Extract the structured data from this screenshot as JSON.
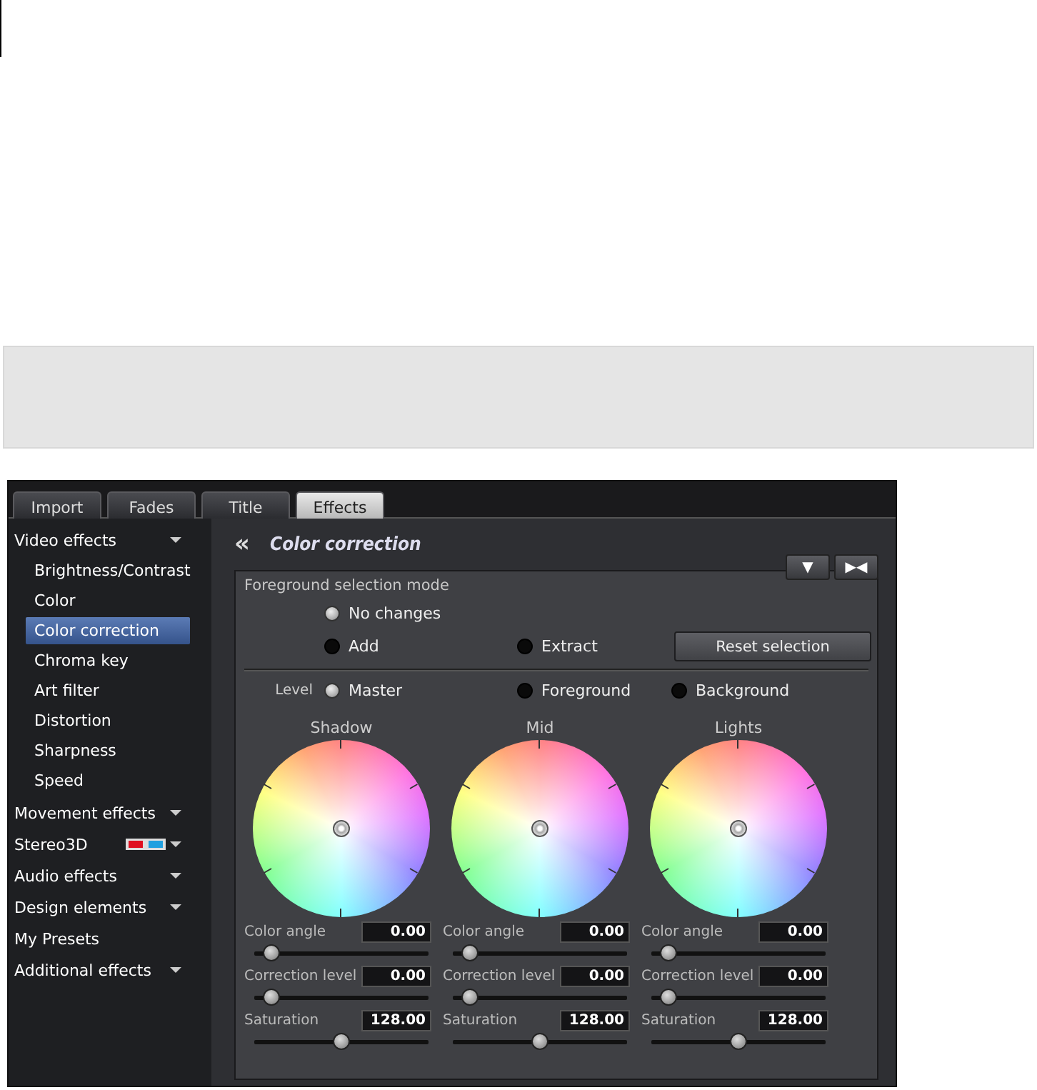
{
  "tabs": [
    {
      "label": "Import",
      "selected": false
    },
    {
      "label": "Fades",
      "selected": false
    },
    {
      "label": "Title",
      "selected": false
    },
    {
      "label": "Effects",
      "selected": true
    }
  ],
  "sidebar": {
    "items": [
      {
        "label": "Video effects",
        "kind": "menu",
        "children": [
          {
            "label": "Brightness/Contrast",
            "selected": false
          },
          {
            "label": "Color",
            "selected": false
          },
          {
            "label": "Color correction",
            "selected": true
          },
          {
            "label": "Chroma key",
            "selected": false
          },
          {
            "label": "Art filter",
            "selected": false
          },
          {
            "label": "Distortion",
            "selected": false
          },
          {
            "label": "Sharpness",
            "selected": false
          },
          {
            "label": "Speed",
            "selected": false
          }
        ]
      },
      {
        "label": "Movement effects",
        "kind": "menu"
      },
      {
        "label": "Stereo3D",
        "kind": "menu-3d"
      },
      {
        "label": "Audio effects",
        "kind": "menu"
      },
      {
        "label": "Design elements",
        "kind": "menu"
      },
      {
        "label": "My Presets",
        "kind": "plain"
      },
      {
        "label": "Additional effects",
        "kind": "menu"
      }
    ]
  },
  "panel": {
    "back": "«",
    "title": "Color correction",
    "corner_buttons": [
      "▼",
      "▶◀"
    ],
    "selection_mode": {
      "label": "Foreground selection mode",
      "options": [
        {
          "label": "No changes",
          "selected": true
        },
        {
          "label": "Add",
          "selected": false
        },
        {
          "label": "Extract",
          "selected": false
        }
      ],
      "reset_button": "Reset selection"
    },
    "level": {
      "label": "Level",
      "options": [
        {
          "label": "Master",
          "selected": true
        },
        {
          "label": "Foreground",
          "selected": false
        },
        {
          "label": "Background",
          "selected": false
        }
      ]
    },
    "wheels": [
      {
        "title": "Shadow",
        "params": [
          {
            "label": "Color angle",
            "value": "0.00",
            "level": 0.1
          },
          {
            "label": "Correction level",
            "value": "0.00",
            "level": 0.1
          },
          {
            "label": "Saturation",
            "value": "128.00",
            "level": 0.5
          }
        ]
      },
      {
        "title": "Mid",
        "params": [
          {
            "label": "Color angle",
            "value": "0.00",
            "level": 0.1
          },
          {
            "label": "Correction level",
            "value": "0.00",
            "level": 0.1
          },
          {
            "label": "Saturation",
            "value": "128.00",
            "level": 0.5
          }
        ]
      },
      {
        "title": "Lights",
        "params": [
          {
            "label": "Color angle",
            "value": "0.00",
            "level": 0.1
          },
          {
            "label": "Correction level",
            "value": "0.00",
            "level": 0.1
          },
          {
            "label": "Saturation",
            "value": "128.00",
            "level": 0.5
          }
        ]
      }
    ]
  }
}
